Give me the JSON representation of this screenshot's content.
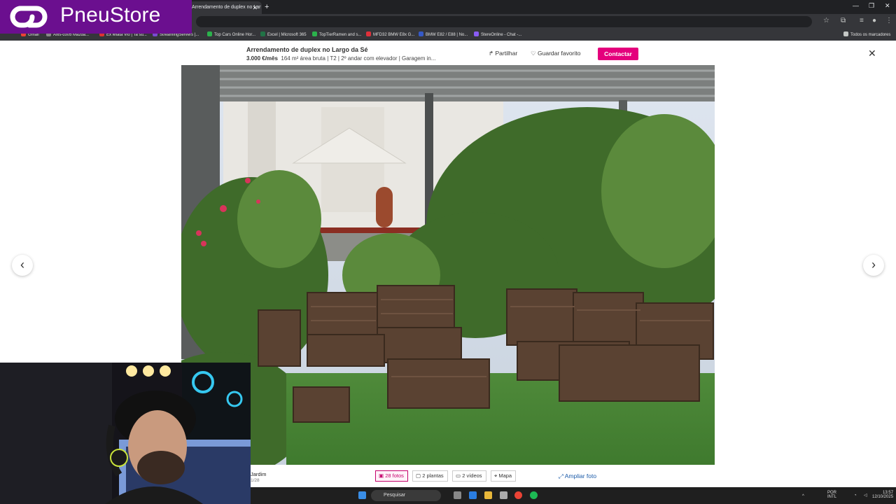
{
  "browser": {
    "tab_title": "Arrendamento de duplex no Lar",
    "bookmarks": [
      "Gmail",
      "Axis-co05 Mazda...",
      "Ex Miata Vlo | Ta su...",
      "StreamingServers |...",
      "Top Cars Online Hor...",
      "Excel | Microsoft 365",
      "TopTierRamen and s...",
      "MFD32 BMW E8x G...",
      "BMW E82 / E88 | No...",
      "StereOnline - Chat -..."
    ],
    "all_bookmarks": "Todos os marcadores"
  },
  "overlay": {
    "brand": "PneuStore"
  },
  "listing": {
    "title": "Arrendamento de duplex no Largo da Sé",
    "price": "3.000 €/mês",
    "details": "164 m² área bruta | T2 | 2º andar com elevador | Garagem in...",
    "share": "Partilhar",
    "favorite": "Guardar favorito",
    "contact": "Contactar"
  },
  "gallery": {
    "caption": "Jardim",
    "counter": "1/28",
    "tabs": [
      {
        "label": "28 fotos",
        "icon": "image-icon"
      },
      {
        "label": "2 plantas",
        "icon": "floorplan-icon"
      },
      {
        "label": "2 vídeos",
        "icon": "video-icon"
      },
      {
        "label": "Mapa",
        "icon": "map-pin-icon"
      }
    ],
    "expand": "Ampliar foto"
  },
  "taskbar": {
    "search_placeholder": "Pesquisar",
    "lang": "POR",
    "lang2": "INTL",
    "time": "13:57",
    "date": "12/10/2025"
  },
  "colors": {
    "brand_purple": "#6b0f8f",
    "contact_pink": "#e4007c"
  }
}
